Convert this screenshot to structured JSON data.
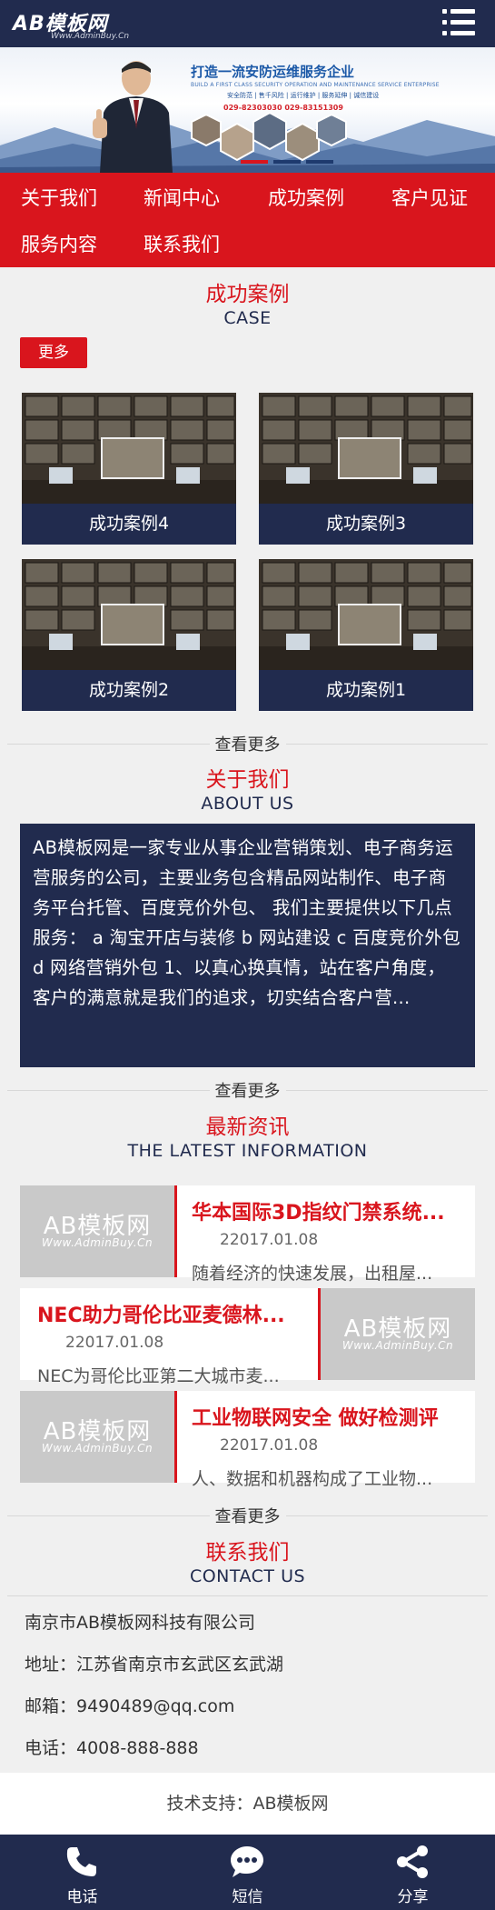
{
  "header": {
    "logo_text": "AB模板网",
    "logo_sub": "Www.AdminBuy.Cn",
    "menu_icon": "hamburger-menu-icon"
  },
  "banner": {
    "title": "打造一流安防运维服务企业",
    "subtitle": "BUILD A FIRST CLASS SECURITY OPERATION AND MAINTENANCE SERVICE ENTERPRISE",
    "tags": "安全防范 | 售千风险 | 运行维护 | 服务延伸 | 诚信建设",
    "phone": "029-82303030    029-83151309"
  },
  "nav": {
    "items": [
      {
        "label": "关于我们"
      },
      {
        "label": "新闻中心"
      },
      {
        "label": "成功案例"
      },
      {
        "label": "客户见证"
      },
      {
        "label": "服务内容"
      },
      {
        "label": "联系我们"
      }
    ]
  },
  "cases": {
    "title": "成功案例",
    "subtitle": "CASE",
    "more_label": "更多",
    "items": [
      {
        "label": "成功案例4"
      },
      {
        "label": "成功案例3"
      },
      {
        "label": "成功案例2"
      },
      {
        "label": "成功案例1"
      }
    ]
  },
  "see_more_label": "查看更多",
  "about": {
    "title": "关于我们",
    "subtitle": "ABOUT US",
    "text": "AB模板网是一家专业从事企业营销策划、电子商务运营服务的公司，主要业务包含精品网站制作、电子商务平台托管、百度竞价外包、 我们主要提供以下几点服务： a 淘宝开店与装修 b 网站建设 c 百度竞价外包 d 网络营销外包 1、以真心换真情，站在客户角度，客户的满意就是我们的追求，切实结合客户营..."
  },
  "news": {
    "title": "最新资讯",
    "subtitle": "THE LATEST INFORMATION",
    "thumb_text": "AB模板网",
    "thumb_sub": "Www.AdminBuy.Cn",
    "items": [
      {
        "title": "华本国际3D指纹门禁系统...",
        "date": "22017.01.08",
        "desc": "随着经济的快速发展，出租屋..."
      },
      {
        "title": "NEC助力哥伦比亚麦德林...",
        "date": "22017.01.08",
        "desc": "NEC为哥伦比亚第二大城市麦..."
      },
      {
        "title": "工业物联网安全 做好检测评",
        "date": "22017.01.08",
        "desc": "人、数据和机器构成了工业物..."
      }
    ]
  },
  "contact": {
    "title": "联系我们",
    "subtitle": "CONTACT US",
    "company": "南京市AB模板网科技有限公司",
    "address": "地址：江苏省南京市玄武区玄武湖",
    "email": "邮箱：9490489@qq.com",
    "phone": "电话：4008-888-888"
  },
  "footer": {
    "support": "技术支持：AB模板网"
  },
  "bottom_bar": {
    "tabs": [
      {
        "label": "电话",
        "icon": "phone-icon"
      },
      {
        "label": "短信",
        "icon": "message-icon"
      },
      {
        "label": "分享",
        "icon": "share-icon"
      }
    ]
  },
  "colors": {
    "navy": "#212b4e",
    "red": "#d9151d",
    "background": "#f0f0f0"
  }
}
